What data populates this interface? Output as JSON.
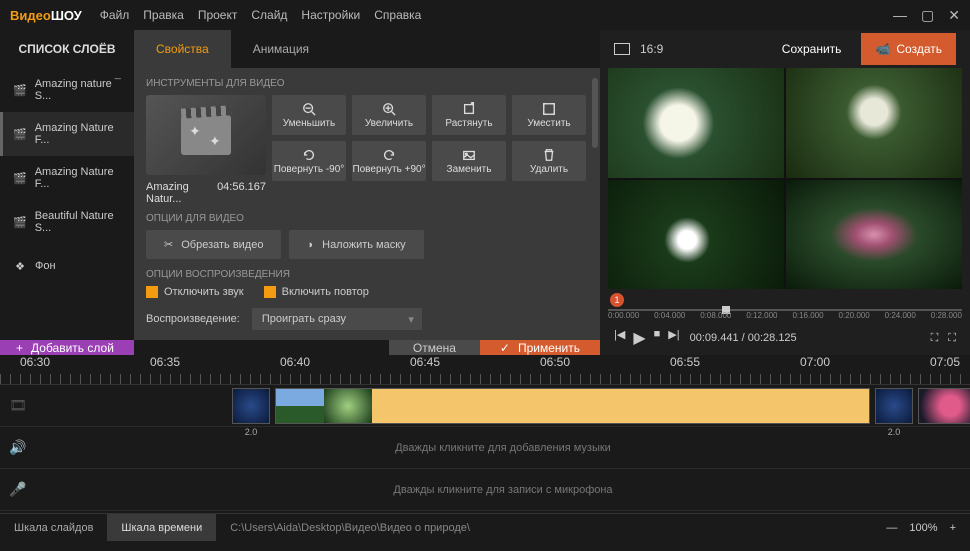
{
  "app": {
    "logo1": "Видео",
    "logo2": "ШОУ"
  },
  "menu": [
    "Файл",
    "Правка",
    "Проект",
    "Слайд",
    "Настройки",
    "Справка"
  ],
  "layers": {
    "title": "СПИСОК СЛОЁВ",
    "items": [
      {
        "label": "Amazing nature ¯ S..."
      },
      {
        "label": "Amazing Nature F..."
      },
      {
        "label": "Amazing Nature F..."
      },
      {
        "label": "Beautiful Nature S..."
      },
      {
        "label": "Фон"
      }
    ]
  },
  "tabs": {
    "props": "Свойства",
    "anim": "Анимация"
  },
  "props": {
    "tools_label": "ИНСТРУМЕНТЫ ДЛЯ ВИДЕО",
    "clip_name": "Amazing Natur...",
    "clip_duration": "04:56.167",
    "tools": [
      "Уменьшить",
      "Увеличить",
      "Растянуть",
      "Уместить",
      "Повернуть -90°",
      "Повернуть +90°",
      "Заменить",
      "Удалить"
    ],
    "options_label": "ОПЦИИ ДЛЯ ВИДЕО",
    "crop": "Обрезать видео",
    "mask": "Наложить маску",
    "playback_label": "ОПЦИИ ВОСПРОИЗВЕДЕНИЯ",
    "mute": "Отключить звук",
    "loop": "Включить повтор",
    "playbk": "Воспроизведение:",
    "playval": "Проиграть сразу"
  },
  "actions": {
    "add_layer": "Добавить слой",
    "cancel": "Отмена",
    "apply": "Применить"
  },
  "preview": {
    "aspect": "16:9",
    "save": "Сохранить",
    "create": "Создать",
    "ruler": [
      "0:00.000",
      "0:04.000",
      "0:08.000",
      "0:12.000",
      "0:16.000",
      "0:20.000",
      "0:24.000",
      "0:28.000"
    ],
    "time": "00:09.441 / 00:28.125"
  },
  "timeline": {
    "labels": {
      "l0": "06:30",
      "l1": "06:35",
      "l2": "06:40",
      "l3": "06:45",
      "l4": "06:50",
      "l5": "06:55",
      "l6": "07:00",
      "l7": "07:05"
    },
    "trans": "2.0",
    "music_hint": "Дважды кликните для добавления музыки",
    "mic_hint": "Дважды кликните для записи с микрофона"
  },
  "status": {
    "slides": "Шкала слайдов",
    "time": "Шкала времени",
    "path": "C:\\Users\\Aida\\Desktop\\Видео\\Видео о природе\\",
    "zoom": "100%"
  }
}
